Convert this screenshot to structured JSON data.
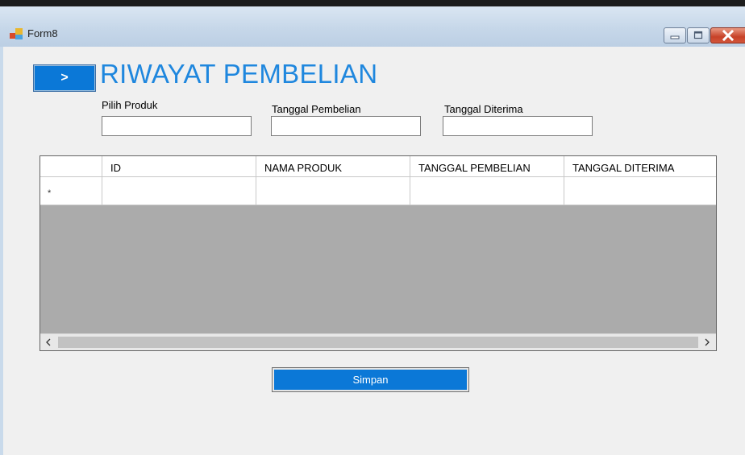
{
  "window": {
    "title": "Form8",
    "titlebar_color": "#c6d7e9",
    "icons": [
      "app-icon",
      "minimize-icon",
      "maximize-icon",
      "close-icon"
    ]
  },
  "header": {
    "nav_button_label": ">",
    "title": "RIWAYAT PEMBELIAN",
    "title_color": "#1f87de",
    "accent_color": "#0b78d7"
  },
  "form": {
    "fields": [
      {
        "label": "Pilih Produk",
        "value": ""
      },
      {
        "label": "Tanggal Pembelian",
        "value": ""
      },
      {
        "label": "Tanggal Diterima",
        "value": ""
      }
    ]
  },
  "grid": {
    "columns": [
      "ID",
      "NAMA PRODUK",
      "TANGGAL PEMBELIAN",
      "TANGGAL DITERIMA"
    ],
    "rows": [
      {
        "marker": "*",
        "cells": [
          "",
          "",
          "",
          ""
        ]
      }
    ],
    "scroll_left_label": "<",
    "scroll_right_label": ">",
    "background_color": "#ababab"
  },
  "actions": {
    "save_label": "Simpan"
  }
}
